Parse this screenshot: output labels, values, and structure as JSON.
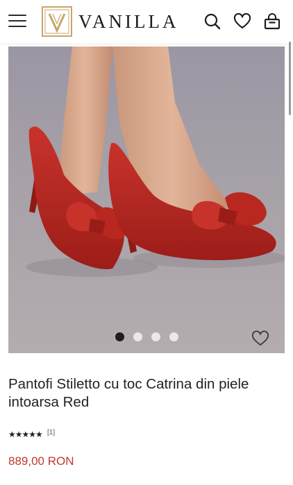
{
  "header": {
    "logo_text": "VANILLA",
    "logo_mark_letter": "V",
    "icons": [
      "menu-icon",
      "search-icon",
      "heart-icon",
      "bag-icon"
    ]
  },
  "gallery": {
    "slide_count": 4,
    "active_slide": 1,
    "image_subject": "Red suede stiletto pumps with bow, worn on feet"
  },
  "product": {
    "title": "Pantofi Stiletto cu toc Catrina din piele intoarsa Red",
    "rating_stars": "★★★★★",
    "rating_value": 5,
    "review_count": "[1]",
    "price": "889,00 RON"
  },
  "colors": {
    "accent_price": "#c0392b",
    "logo_gold": "#c8a46b",
    "shoe_red": "#b5241f"
  }
}
